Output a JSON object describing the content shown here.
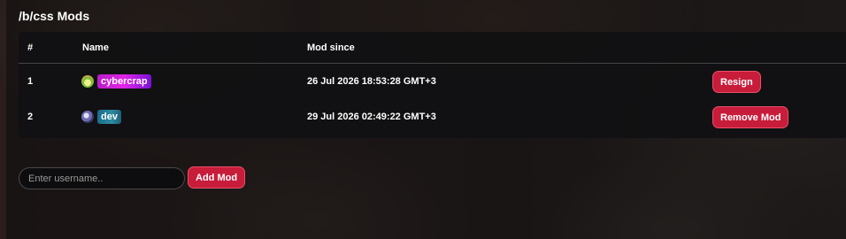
{
  "page": {
    "title": "/b/css Mods"
  },
  "table": {
    "headers": {
      "index": "#",
      "name": "Name",
      "mod_since": "Mod since"
    },
    "rows": [
      {
        "index": "1",
        "name": "cybercrap",
        "mod_since": "26 Jul 2026 18:53:28 GMT+3",
        "action": "Resign"
      },
      {
        "index": "2",
        "name": "dev",
        "mod_since": "29 Jul 2026 02:49:22 GMT+3",
        "action": "Remove Mod"
      }
    ]
  },
  "add_mod": {
    "placeholder": "Enter username..",
    "button_label": "Add Mod"
  },
  "colors": {
    "accent": "#c81c3b",
    "tag_cybercrap": "#e024e6",
    "tag_dev": "#2d8ca0"
  }
}
